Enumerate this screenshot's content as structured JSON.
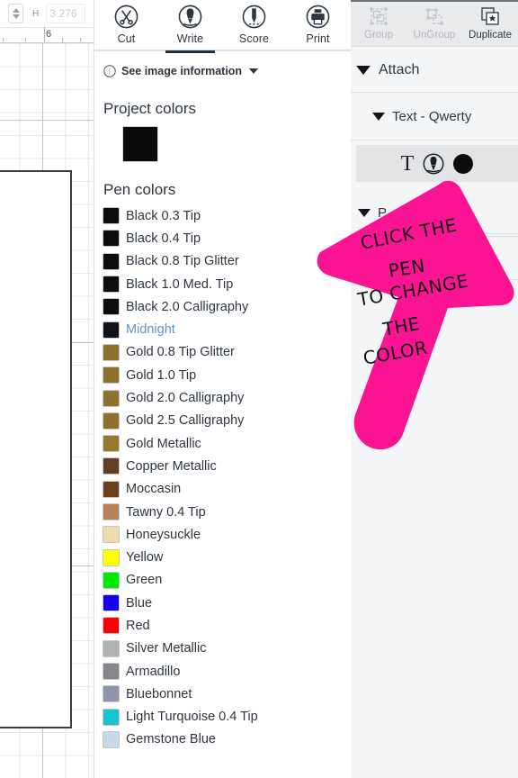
{
  "canvas": {
    "stepper_name": "height-stepper",
    "dimension_label": "H",
    "dimension_value": "3.276",
    "ruler_marks": [
      "6"
    ]
  },
  "mode_tabs": {
    "active": "Write",
    "items": [
      {
        "label": "Cut",
        "icon": "scissors-icon"
      },
      {
        "label": "Write",
        "icon": "pen-icon"
      },
      {
        "label": "Score",
        "icon": "scoring-stylus-icon"
      },
      {
        "label": "Print",
        "icon": "printer-icon"
      }
    ]
  },
  "info_bar": {
    "icon": "info-icon",
    "label": "See image information",
    "caret": "chevron-down-icon"
  },
  "project_colors": {
    "title": "Project colors",
    "swatches": [
      {
        "name": "Black",
        "hex": "#0a0a0a"
      }
    ]
  },
  "pen_colors": {
    "title": "Pen colors",
    "hovered": "Midnight",
    "hover_text_color": "#5f94d8",
    "items": [
      {
        "label": "Black 0.3 Tip",
        "hex": "#0d0d0d"
      },
      {
        "label": "Black 0.4 Tip",
        "hex": "#0d0d0d"
      },
      {
        "label": "Black 0.8 Tip Glitter",
        "hex": "#0d0d0d"
      },
      {
        "label": "Black 1.0 Med. Tip",
        "hex": "#0d0d0d"
      },
      {
        "label": "Black 2.0 Calligraphy",
        "hex": "#0d0d0d"
      },
      {
        "label": "Midnight",
        "hex": "#111318"
      },
      {
        "label": "Gold 0.8 Tip Glitter",
        "hex": "#8d712c"
      },
      {
        "label": "Gold 1.0 Tip",
        "hex": "#8d712c"
      },
      {
        "label": "Gold 2.0 Calligraphy",
        "hex": "#8d712c"
      },
      {
        "label": "Gold 2.5 Calligraphy",
        "hex": "#8d712c"
      },
      {
        "label": "Gold Metallic",
        "hex": "#94792f"
      },
      {
        "label": "Copper Metallic",
        "hex": "#5f4027"
      },
      {
        "label": "Moccasin",
        "hex": "#6b3f19"
      },
      {
        "label": "Tawny 0.4 Tip",
        "hex": "#b9815a"
      },
      {
        "label": "Honeysuckle",
        "hex": "#ecdcb0"
      },
      {
        "label": "Yellow",
        "hex": "#ffff00"
      },
      {
        "label": "Green",
        "hex": "#00e900"
      },
      {
        "label": "Blue",
        "hex": "#1400f0"
      },
      {
        "label": "Red",
        "hex": "#fa0007"
      },
      {
        "label": "Silver Metallic",
        "hex": "#b0b2b5"
      },
      {
        "label": "Armadillo",
        "hex": "#86888b"
      },
      {
        "label": "Bluebonnet",
        "hex": "#9094ad"
      },
      {
        "label": "Light Turquoise 0.4 Tip",
        "hex": "#17c3cd"
      },
      {
        "label": "Gemstone Blue",
        "hex": "#c8d9e8"
      }
    ]
  },
  "edit_toolbar": {
    "items": [
      {
        "label": "Group",
        "icon": "group-icon",
        "enabled": false
      },
      {
        "label": "UnGroup",
        "icon": "ungroup-icon",
        "enabled": false
      },
      {
        "label": "Duplicate",
        "icon": "duplicate-icon",
        "enabled": true
      }
    ]
  },
  "layers": {
    "attach": {
      "label": "Attach",
      "caret": "triangle-down-icon"
    },
    "group": {
      "label": "Text - Qwerty",
      "caret": "triangle-down-icon"
    },
    "layer_row": {
      "type_icon": "text-T-icon",
      "type_glyph": "T",
      "tool_icon": "pen-icon",
      "color_swatch": "color-dot",
      "color_hex": "#0b0b0b"
    },
    "next_group": {
      "label": "P",
      "caret": "triangle-down-icon"
    }
  },
  "annotation": {
    "shape": "arrow-up-right",
    "color": "#fa1493",
    "lines": [
      "CLICK THE",
      "PEN",
      "TO CHANGE",
      "THE",
      "COLOR"
    ]
  }
}
